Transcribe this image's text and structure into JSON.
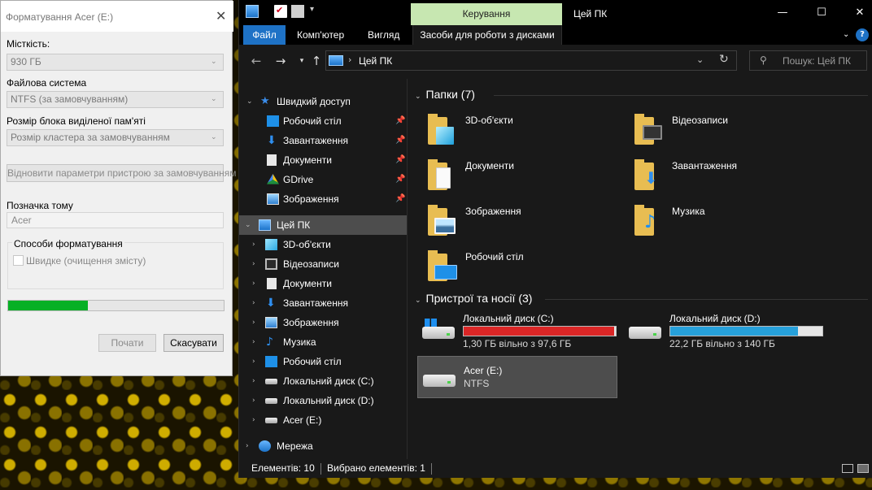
{
  "explorer": {
    "title": "Цей ПК",
    "context_tab": "Керування",
    "window_controls": {
      "minimize": "—",
      "maximize": "☐",
      "close": "✕"
    },
    "ribbon": {
      "file": "Файл",
      "computer": "Комп'ютер",
      "view": "Вигляд",
      "disk_tools": "Засоби для роботи з дисками"
    },
    "address": {
      "path": "Цей ПК",
      "breadcrumb_arrow": "›"
    },
    "search": {
      "placeholder": "Пошук: Цей ПК"
    },
    "nav_pane": {
      "quick_access": "Швидкий доступ",
      "quick_items": [
        "Робочий стіл",
        "Завантаження",
        "Документи",
        "GDrive",
        "Зображення"
      ],
      "this_pc": "Цей ПК",
      "pc_items": [
        "3D-об'єкти",
        "Відеозаписи",
        "Документи",
        "Завантаження",
        "Зображення",
        "Музика",
        "Робочий стіл",
        "Локальний диск (C:)",
        "Локальний диск (D:)",
        "Acer (E:)"
      ],
      "network": "Мережа"
    },
    "folders_group": "Папки (7)",
    "folders": [
      "3D-об'єкти",
      "Відеозаписи",
      "Документи",
      "Завантаження",
      "Зображення",
      "Музика",
      "Робочий стіл"
    ],
    "devices_group": "Пристрої та носії (3)",
    "drives": [
      {
        "name": "Локальний диск (C:)",
        "free": "1,30 ГБ вільно з 97,6 ГБ",
        "used_fraction": 0.987,
        "color": "#da2626"
      },
      {
        "name": "Локальний диск (D:)",
        "free": "22,2 ГБ вільно з 140 ГБ",
        "used_fraction": 0.841,
        "color": "#26a0da"
      },
      {
        "name": "Acer (E:)",
        "fs": "NTFS"
      }
    ],
    "status": {
      "count": "Елементів: 10",
      "selected": "Вибрано елементів: 1"
    }
  },
  "format_dialog": {
    "title": "Форматування Acer (E:)",
    "capacity_label": "Місткість:",
    "capacity_value": "930 ГБ",
    "fs_label": "Файлова система",
    "fs_value": "NTFS (за замовчуванням)",
    "cluster_label": "Розмір блока виділеної пам'яті",
    "cluster_value": "Розмір кластера за замовчуванням",
    "restore_button": "Відновити параметри пристрою за замовчуванням",
    "volume_label_label": "Позначка тому",
    "volume_label_value": "Acer",
    "format_options_label": "Способи форматування",
    "quick_format_label": "Швидке (очищення змісту)",
    "quick_format_checked": false,
    "progress_fraction": 0.37,
    "start_button": "Почати",
    "cancel_button": "Скасувати"
  },
  "colors": {
    "accent": "#1e72c6",
    "context_tab": "#c7e7b1",
    "progress": "#06b025"
  }
}
